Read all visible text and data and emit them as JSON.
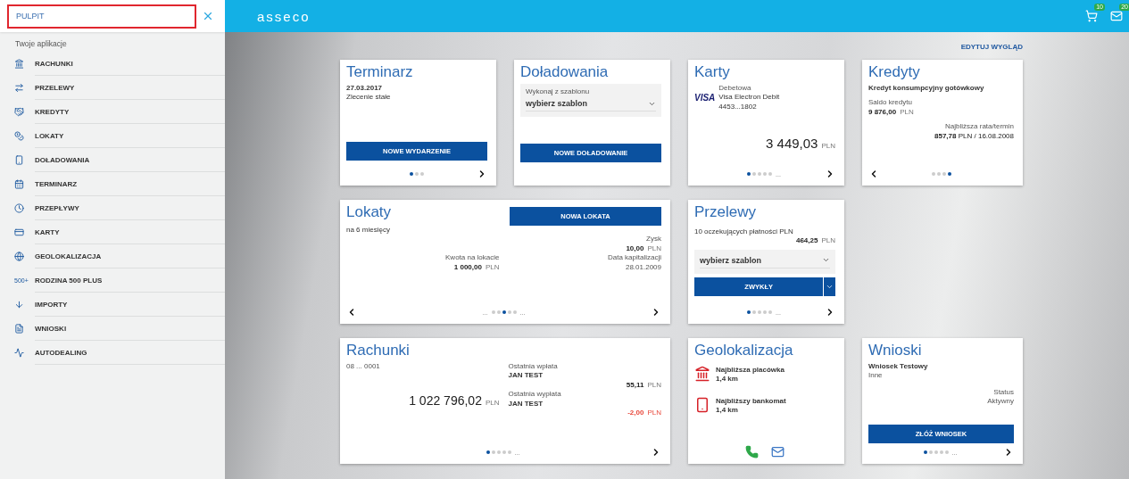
{
  "search": {
    "value": "PULPIT"
  },
  "sidebar": {
    "heading": "Twoje aplikacje",
    "items": [
      {
        "label": "RACHUNKI"
      },
      {
        "label": "PRZELEWY"
      },
      {
        "label": "KREDYTY"
      },
      {
        "label": "LOKATY"
      },
      {
        "label": "DOŁADOWANIA"
      },
      {
        "label": "TERMINARZ"
      },
      {
        "label": "PRZEPŁYWY"
      },
      {
        "label": "KARTY"
      },
      {
        "label": "GEOLOKALIZACJA"
      },
      {
        "label": "RODZINA 500 PLUS",
        "icon_label": "500+"
      },
      {
        "label": "IMPORTY"
      },
      {
        "label": "WNIOSKI"
      },
      {
        "label": "AUTODEALING"
      }
    ]
  },
  "topbar": {
    "logo": "asseco",
    "cart_badge": "10",
    "mail_badge": "20"
  },
  "edit_link": "EDYTUJ WYGLĄD",
  "cards": [
    {
      "kind": "terminarz",
      "title": "Terminarz",
      "date": "27.03.2017",
      "description": "Zlecenie stałe",
      "button": "NOWE WYDARZENIE",
      "pager": {
        "prev": false,
        "next": true,
        "dots": [
          {
            "selected": true
          },
          {
            "selected": false
          },
          {
            "selected": false
          }
        ]
      }
    },
    {
      "kind": "doladowania",
      "title": "Doładowania",
      "select_label": "Wykonaj z szablonu",
      "select_value": "wybierz szablon",
      "button": "NOWE DOŁADOWANIE"
    },
    {
      "kind": "karty",
      "title": "Karty",
      "card_type": "Debetowa",
      "card_brand": "VISA",
      "card_name": "Visa Electron Debit",
      "card_number": "4453...1802",
      "amount": {
        "value": "3 449,03",
        "currency": "PLN"
      },
      "pager": {
        "prev": false,
        "next": true,
        "dots": [
          {
            "selected": true
          },
          {
            "selected": false
          },
          {
            "selected": false
          },
          {
            "selected": false
          },
          {
            "selected": false
          }
        ],
        "trail": "..."
      }
    },
    {
      "kind": "kredyty",
      "title": "Kredyty",
      "product": "Kredyt konsumpcyjny gotówkowy",
      "balance_label": "Saldo kredytu",
      "balance": {
        "value": "9 876,00",
        "currency": "PLN"
      },
      "next_label": "Najbliższa rata/termin",
      "next_amount": "857,78",
      "next_rest": "PLN / 16.08.2008",
      "pager": {
        "prev": true,
        "next": false,
        "dots": [
          {
            "selected": false
          },
          {
            "selected": false
          },
          {
            "selected": false
          },
          {
            "selected": true
          }
        ]
      }
    },
    {
      "kind": "lokaty",
      "title": "Lokaty",
      "button": "NOWA LOKATA",
      "term": "na 6 miesięcy",
      "profit_label": "Zysk",
      "profit": {
        "value": "10,00",
        "currency": "PLN"
      },
      "amount_label": "Kwota na lokacie",
      "amount": {
        "value": "1 000,00",
        "currency": "PLN"
      },
      "date_label": "Data kapitalizacji",
      "date": "28.01.2009",
      "pager": {
        "prev": true,
        "next": true,
        "lead": "...",
        "dots": [
          {
            "selected": false
          },
          {
            "selected": false
          },
          {
            "selected": true
          },
          {
            "selected": false
          },
          {
            "selected": false
          }
        ],
        "trail": "..."
      }
    },
    {
      "kind": "przelewy",
      "title": "Przelewy",
      "pending": "10 oczekujących płatności PLN",
      "pending_amount": {
        "value": "464,25",
        "currency": "PLN"
      },
      "select_value": "wybierz szablon",
      "button": "ZWYKŁY",
      "pager": {
        "prev": false,
        "next": true,
        "dots": [
          {
            "selected": true
          },
          {
            "selected": false
          },
          {
            "selected": false
          },
          {
            "selected": false
          },
          {
            "selected": false
          }
        ],
        "trail": "..."
      }
    },
    {
      "kind": "rachunki",
      "title": "Rachunki",
      "account": "08 ... 0001",
      "balance": {
        "value": "1 022 796,02",
        "currency": "PLN"
      },
      "deposit_label": "Ostatnia wpłata",
      "deposit_name": "JAN TEST",
      "deposit": {
        "value": "55,11",
        "currency": "PLN"
      },
      "withdrawal_label": "Ostatnia wypłata",
      "withdrawal_name": "JAN TEST",
      "withdrawal": {
        "value": "-2,00",
        "currency": "PLN"
      },
      "pager": {
        "prev": false,
        "next": true,
        "dots": [
          {
            "selected": true
          },
          {
            "selected": false
          },
          {
            "selected": false
          },
          {
            "selected": false
          },
          {
            "selected": false
          }
        ],
        "trail": "..."
      }
    },
    {
      "kind": "geolokalizacja",
      "title": "Geolokalizacja",
      "branch_label": "Najbliższa placówka",
      "branch_distance": "1,4 km",
      "atm_label": "Najbliższy bankomat",
      "atm_distance": "1,4 km"
    },
    {
      "kind": "wnioski",
      "title": "Wnioski",
      "request": "Wniosek Testowy",
      "request_type": "Inne",
      "status_label": "Status",
      "status": "Aktywny",
      "button": "ZŁÓŻ WNIOSEK",
      "pager": {
        "prev": false,
        "next": true,
        "dots": [
          {
            "selected": true
          },
          {
            "selected": false
          },
          {
            "selected": false
          },
          {
            "selected": false
          },
          {
            "selected": false
          }
        ],
        "trail": "..."
      }
    }
  ]
}
